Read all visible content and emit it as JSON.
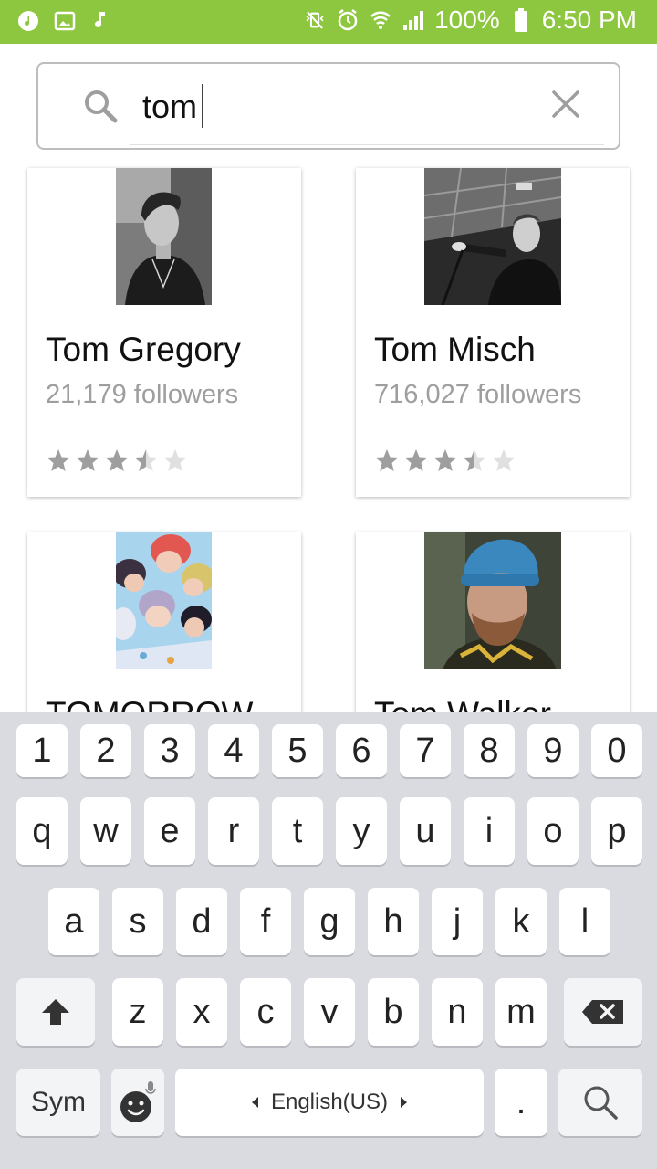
{
  "status_bar": {
    "battery": "100%",
    "time": "6:50 PM",
    "left_icons": [
      "music-circle-icon",
      "image-icon",
      "music-note-icon"
    ],
    "right_icons": [
      "vibrate-mute-icon",
      "alarm-icon",
      "wifi-icon",
      "signal-icon",
      "battery-icon"
    ]
  },
  "search": {
    "query": "tom"
  },
  "results": [
    {
      "name": "Tom Gregory",
      "followers": "21,179 followers",
      "rating": 3.5
    },
    {
      "name": "Tom Misch",
      "followers": "716,027 followers",
      "rating": 3.5
    },
    {
      "name": "TOMORROW",
      "followers": "",
      "rating": 0
    },
    {
      "name": "Tom Walker",
      "followers": "",
      "rating": 0
    }
  ],
  "keyboard": {
    "row_numbers": [
      "1",
      "2",
      "3",
      "4",
      "5",
      "6",
      "7",
      "8",
      "9",
      "0"
    ],
    "row_top": [
      "q",
      "w",
      "e",
      "r",
      "t",
      "y",
      "u",
      "i",
      "o",
      "p"
    ],
    "row_mid": [
      "a",
      "s",
      "d",
      "f",
      "g",
      "h",
      "j",
      "k",
      "l"
    ],
    "row_bottom": [
      "z",
      "x",
      "c",
      "v",
      "b",
      "n",
      "m"
    ],
    "sym_label": "Sym",
    "space_label": "English(US)",
    "period_label": "."
  },
  "colors": {
    "status_bar": "#8dc63f",
    "keyboard_bg": "#d9dbe1",
    "star_filled": "#9e9e9e",
    "star_empty": "#e0e0e0"
  }
}
